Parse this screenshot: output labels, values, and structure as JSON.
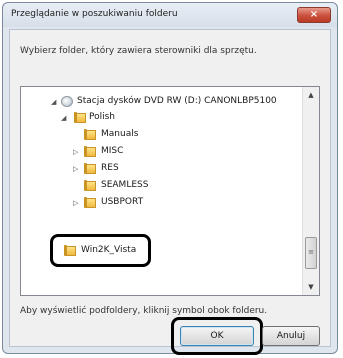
{
  "dialog": {
    "title": "Przeglądanie w poszukiwaniu folderu",
    "close_label": "×",
    "description": "Wybierz folder, który zawiera sterowniki dla sprzętu.",
    "hint": "Aby wyświetlić podfoldery, kliknij symbol obok folderu.",
    "ok_label": "OK",
    "cancel_label": "Anuluj"
  },
  "tree": {
    "items": [
      {
        "label": "Stacja dysków DVD RW (D:) CANONLBP5100",
        "expander": "◢",
        "icon": "dvd-drive-icon"
      },
      {
        "label": "Polish",
        "expander": "◢",
        "icon": "folder-icon"
      },
      {
        "label": "Manuals",
        "expander": "",
        "icon": "folder-icon"
      },
      {
        "label": "MISC",
        "expander": "▷",
        "icon": "folder-icon"
      },
      {
        "label": "RES",
        "expander": "▷",
        "icon": "folder-icon"
      },
      {
        "label": "SEAMLESS",
        "expander": "",
        "icon": "folder-icon"
      },
      {
        "label": "USBPORT",
        "expander": "▷",
        "icon": "folder-icon"
      },
      {
        "label": "Win2K_Vista",
        "expander": "",
        "icon": "folder-icon",
        "selected": true
      }
    ]
  },
  "scrollbar": {
    "up_arrow": "▲",
    "down_arrow": "▼",
    "thumb_grip": "≡"
  }
}
